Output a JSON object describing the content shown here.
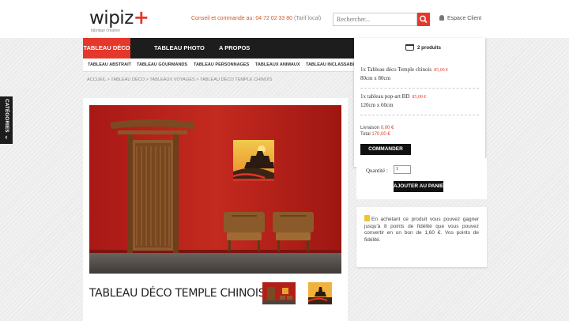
{
  "brand": {
    "logo_text": "wipiz",
    "logo_plus": "+",
    "tagline": "fabrique créative"
  },
  "header": {
    "contact_label": "Conseil et commande au:",
    "phone": "04 72 02 33 80",
    "phone_note": "(Tarif local)",
    "search_placeholder": "Rechercher...",
    "account_label": "Espace Client"
  },
  "nav": {
    "items": [
      {
        "label": "Tableau déco",
        "active": true
      },
      {
        "label": "Tableau photo",
        "active": false
      },
      {
        "label": "A propos",
        "active": false
      }
    ]
  },
  "subnav": {
    "items": [
      "Tableau abstrait",
      "Tableau gourmands",
      "Tableau personnages",
      "Tableaux animaux",
      "Tableau inclassables"
    ]
  },
  "breadcrumb": "Accueil > Tableau déco > Tableaux voyages > Tableau déco temple chinois",
  "sidebar": {
    "categories_label": "Catégories",
    "chevron": "‹"
  },
  "product": {
    "title": "TABLEAU DÉCO TEMPLE CHINOIS"
  },
  "cart": {
    "count_label": "2 produits",
    "items": [
      {
        "line1": "1x Tableau déco Temple chinois",
        "price": "85,00 €",
        "line2": "80cm x 80cm"
      },
      {
        "line1": "1x tableau pop-art BD",
        "price": "85,00 €",
        "line2": "120cm x 60cm"
      }
    ],
    "shipping_label": "Livraison",
    "shipping_value": "0,00 €",
    "total_label": "Total",
    "total_value": "170,00 €",
    "checkout_button": "Commander"
  },
  "order": {
    "quantity_label": "Quantité :",
    "quantity_value": "1",
    "add_to_cart_button": "Ajouter au panier"
  },
  "loyalty": {
    "text": "En achetant ce produit vous pouvez gagner jusqu'à 8 points de fidélité que vous pouvez convertir en un bon de 1,60 €. Vos points de fidélité."
  },
  "colors": {
    "accent": "#e4382c",
    "dark": "#1d1d1d"
  }
}
